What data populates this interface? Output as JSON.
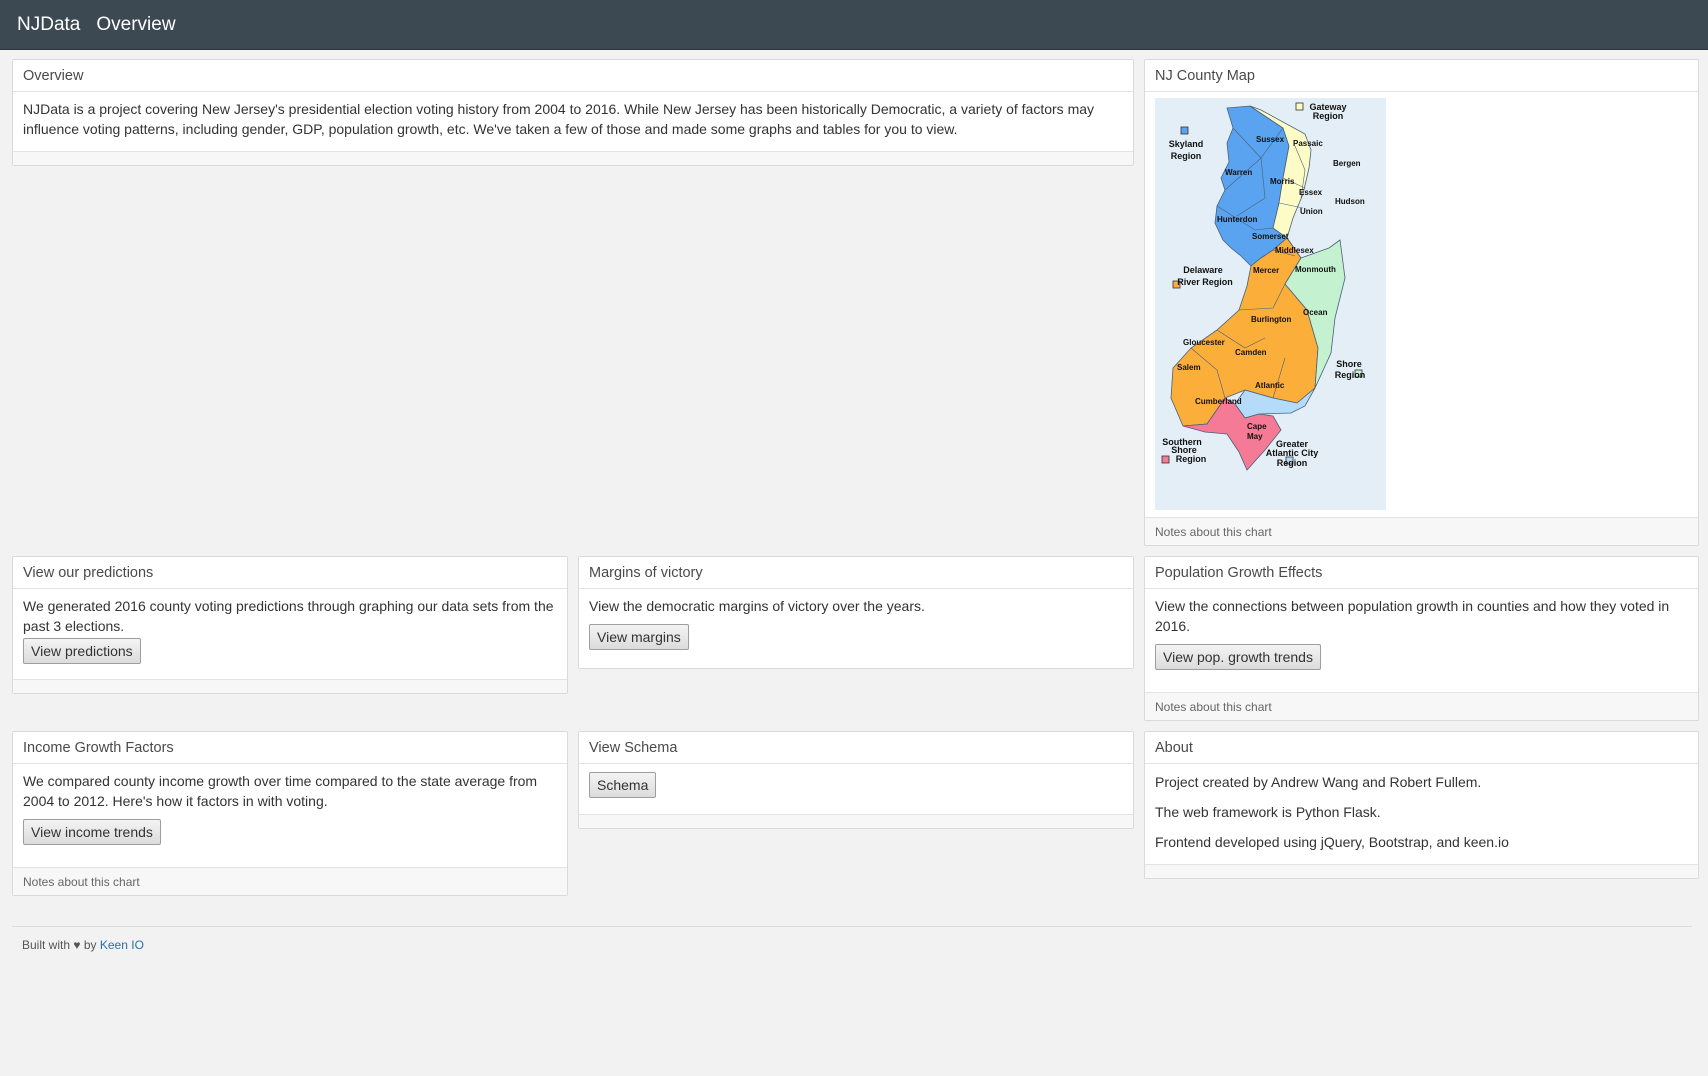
{
  "navbar": {
    "brand": "NJData",
    "link": "Overview"
  },
  "overview": {
    "title": "Overview",
    "text": "NJData is a project covering New Jersey's presidential election voting history from 2004 to 2016. While New Jersey has been historically Democratic, a variety of factors may influence voting patterns, including gender, GDP, population growth, etc. We've taken a few of those and made some graphs and tables for you to view."
  },
  "map_panel": {
    "title": "NJ County Map",
    "notes": "Notes about this chart",
    "counties": [
      "Sussex",
      "Passaic",
      "Bergen",
      "Warren",
      "Morris",
      "Essex",
      "Hudson",
      "Union",
      "Hunterdon",
      "Somerset",
      "Middlesex",
      "Mercer",
      "Monmouth",
      "Burlington",
      "Ocean",
      "Gloucester",
      "Camden",
      "Salem",
      "Atlantic",
      "Cumberland",
      "Cape",
      "May"
    ],
    "regions": {
      "gateway": [
        "Gateway",
        "Region"
      ],
      "skyland": [
        "Skyland",
        "Region"
      ],
      "delaware": [
        "Delaware",
        "River Region"
      ],
      "shore": [
        "Shore",
        "Region"
      ],
      "southern": [
        "Southern",
        "Shore",
        "Region"
      ],
      "atlantic_city": [
        "Greater",
        "Atlantic City",
        "Region"
      ]
    },
    "colors": {
      "skyland": "#5aa3f0",
      "gateway": "#fdfbc6",
      "delaware": "#fcae3a",
      "shore": "#c4f1cf",
      "southern": "#f57a96",
      "atlantic_city": "#b4dcfa",
      "background": "#e3eef6"
    }
  },
  "predictions": {
    "title": "View our predictions",
    "text": "We generated 2016 county voting predictions through graphing our data sets from the past 3 elections.",
    "button": "View predictions"
  },
  "margins": {
    "title": "Margins of victory",
    "text": "View the democratic margins of victory over the years.",
    "button": "View margins"
  },
  "population": {
    "title": "Population Growth Effects",
    "text": "View the connections between population growth in counties and how they voted in 2016.",
    "button": "View pop. growth trends",
    "notes": "Notes about this chart"
  },
  "income": {
    "title": "Income Growth Factors",
    "text": "We compared county income growth over time compared to the state average from 2004 to 2012. Here's how it factors in with voting.",
    "button": "View income trends",
    "notes": "Notes about this chart"
  },
  "schema": {
    "title": "View Schema",
    "button": "Schema"
  },
  "about": {
    "title": "About",
    "line1": "Project created by Andrew Wang and Robert Fullem.",
    "line2": "The web framework is Python Flask.",
    "line3": "Frontend developed using jQuery, Bootstrap, and keen.io"
  },
  "footer": {
    "prefix": "Built with",
    "heart": "♥",
    "by": "by",
    "link": "Keen IO"
  }
}
